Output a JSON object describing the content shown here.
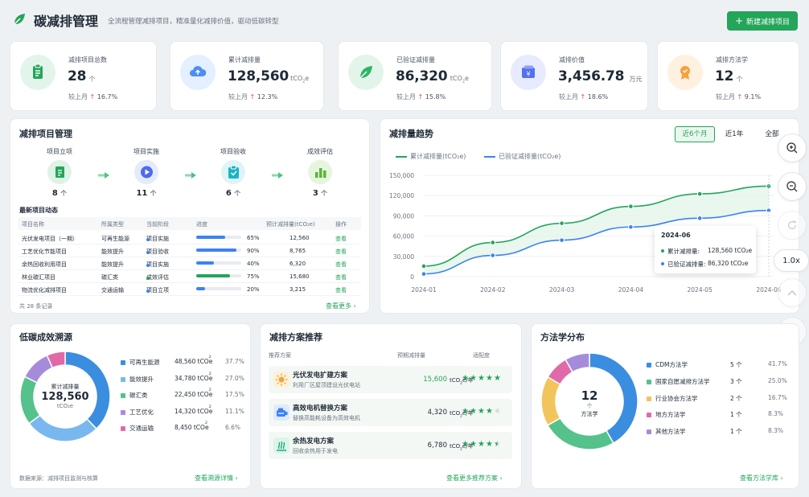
{
  "header": {
    "title": "碳减排管理",
    "subtitle": "全流程管理减排项目，精准量化减排价值，驱动低碳转型",
    "new_button": "新建减排项目"
  },
  "stats": [
    {
      "label": "减排项目总数",
      "value": "28",
      "unit": "个",
      "compare": "较上月",
      "change": "16.7%"
    },
    {
      "label": "累计减排量",
      "value": "128,560",
      "unit": "tCO₂e",
      "compare": "较上月",
      "change": "12.3%"
    },
    {
      "label": "已验证减排量",
      "value": "86,320",
      "unit": "tCO₂e",
      "compare": "较上月",
      "change": "15.8%"
    },
    {
      "label": "减排价值",
      "value": "3,456.78",
      "unit": "万元",
      "compare": "较上月",
      "change": "18.6%"
    },
    {
      "label": "减排方法学",
      "value": "12",
      "unit": "个",
      "compare": "较上月",
      "change": "9.1%"
    }
  ],
  "projects": {
    "title": "减排项目管理",
    "stages": [
      {
        "label": "项目立项",
        "count": "8",
        "unit": "个"
      },
      {
        "label": "项目实施",
        "count": "11",
        "unit": "个"
      },
      {
        "label": "项目验收",
        "count": "6",
        "unit": "个"
      },
      {
        "label": "成效评估",
        "count": "3",
        "unit": "个"
      }
    ],
    "recent_title": "最新项目动态",
    "headers": [
      "项目名称",
      "所属类型",
      "当前阶段",
      "进度",
      "预计减排量(tCO₂e)",
      "操作"
    ],
    "rows": [
      {
        "name": "光伏发电项目（一期）",
        "type": "可再生能源",
        "stage": "项目实施",
        "progress": 0.65,
        "progress_text": "65%",
        "amount": "12,560",
        "action": "查看",
        "color": "#3b82f6"
      },
      {
        "name": "工艺优化节能项目",
        "type": "能效提升",
        "stage": "项目验收",
        "progress": 0.9,
        "progress_text": "90%",
        "amount": "8,765",
        "action": "查看",
        "color": "#3b82f6"
      },
      {
        "name": "余热回收利用项目",
        "type": "能效提升",
        "stage": "项目实施",
        "progress": 0.4,
        "progress_text": "40%",
        "amount": "6,320",
        "action": "查看",
        "color": "#3b82f6"
      },
      {
        "name": "林业碳汇项目",
        "type": "碳汇类",
        "stage": "成效评估",
        "progress": 0.75,
        "progress_text": "75%",
        "amount": "15,680",
        "action": "查看",
        "color": "#23a55a"
      },
      {
        "name": "物流优化减排项目",
        "type": "交通运输",
        "stage": "项目立项",
        "progress": 0.2,
        "progress_text": "20%",
        "amount": "3,215",
        "action": "查看",
        "color": "#3b82f6"
      }
    ],
    "total": "共 28 条记录",
    "more": "查看更多"
  },
  "trend": {
    "title": "减排量趋势",
    "tabs": [
      "近6个月",
      "近1年",
      "全部"
    ],
    "series_labels": [
      "累计减排量(tCO₂e)",
      "已验证减排量(tCO₂e)"
    ],
    "tooltip": {
      "month": "2024-06",
      "cum_label": "累计减排量:",
      "cum_value": "128,560 tCO₂e",
      "ver_label": "已验证减排量:",
      "ver_value": "86,320 tCO₂e"
    }
  },
  "chart_data": {
    "type": "line",
    "x": [
      "2024-01",
      "2024-02",
      "2024-03",
      "2024-04",
      "2024-05",
      "2024-06"
    ],
    "series": [
      {
        "name": "累计减排量(tCO₂e)",
        "values": [
          15500,
          50500,
          79000,
          104000,
          122500,
          134000
        ],
        "color": "#23a55a"
      },
      {
        "name": "已验证减排量(tCO₂e)",
        "values": [
          4000,
          31500,
          54000,
          73500,
          86500,
          98000
        ],
        "color": "#3b82f6"
      }
    ],
    "yticks": [
      "0",
      "30,000",
      "60,000",
      "90,000",
      "120,000",
      "150,000"
    ],
    "ylim": [
      0,
      150000
    ]
  },
  "sources": {
    "title": "低碳成效溯源",
    "center_label": "累计减排量",
    "center_value": "128,560",
    "center_unit": "tCO₂e",
    "items": [
      {
        "name": "可再生能源",
        "value": "48,560 tCO₂e",
        "pct": "37.7%",
        "share": 37.7,
        "color": "#3b8de0"
      },
      {
        "name": "能效提升",
        "value": "34,780 tCO₂e",
        "pct": "27.0%",
        "share": 27.0,
        "color": "#79b8ee"
      },
      {
        "name": "碳汇类",
        "value": "22,450 tCO₂e",
        "pct": "17.5%",
        "share": 17.5,
        "color": "#54c28a"
      },
      {
        "name": "工艺优化",
        "value": "14,320 tCO₂e",
        "pct": "11.1%",
        "share": 11.1,
        "color": "#a78bdb"
      },
      {
        "name": "交通运输",
        "value": "8,450 tCO₂e",
        "pct": "6.6%",
        "share": 6.6,
        "color": "#e06aa8"
      }
    ],
    "footnote": "数据来源：减排项目监测与核算",
    "more": "查看溯源详情"
  },
  "recommend": {
    "title": "减排方案推荐",
    "headers": [
      "推荐方案",
      "预期减排量",
      "适配度"
    ],
    "items": [
      {
        "name": "光伏发电扩建方案",
        "desc": "利用厂区屋顶建设光伏电站",
        "amount": "15,600",
        "unit": "tCO₂e/年",
        "stars": 5
      },
      {
        "name": "高效电机替换方案",
        "desc": "替换高能耗设备为高效电机",
        "amount": "4,320",
        "unit": "tCO₂e/年",
        "stars": 4
      },
      {
        "name": "余热发电方案",
        "desc": "回收余热用于发电",
        "amount": "6,780",
        "unit": "tCO₂e/年",
        "stars": 4.5
      }
    ],
    "more": "查看更多推荐方案"
  },
  "methods": {
    "title": "方法学分布",
    "center_value": "12",
    "center_unit": "个",
    "center_label": "方法学",
    "items": [
      {
        "name": "CDM方法学",
        "count": "5 个",
        "pct": "41.7%",
        "share": 41.7,
        "color": "#3b8de0"
      },
      {
        "name": "国家自愿减排方法学",
        "count": "3 个",
        "pct": "25.0%",
        "share": 25.0,
        "color": "#54c28a"
      },
      {
        "name": "行业协会方法学",
        "count": "2 个",
        "pct": "16.7%",
        "share": 16.7,
        "color": "#f2c55c"
      },
      {
        "name": "地方方法学",
        "count": "1 个",
        "pct": "8.3%",
        "share": 8.3,
        "color": "#e06aa8"
      },
      {
        "name": "其他方法学",
        "count": "1 个",
        "pct": "8.3%",
        "share": 8.3,
        "color": "#a78bdb"
      }
    ],
    "more": "查看方法学库"
  },
  "controls": {
    "zoom": "1.0x"
  }
}
